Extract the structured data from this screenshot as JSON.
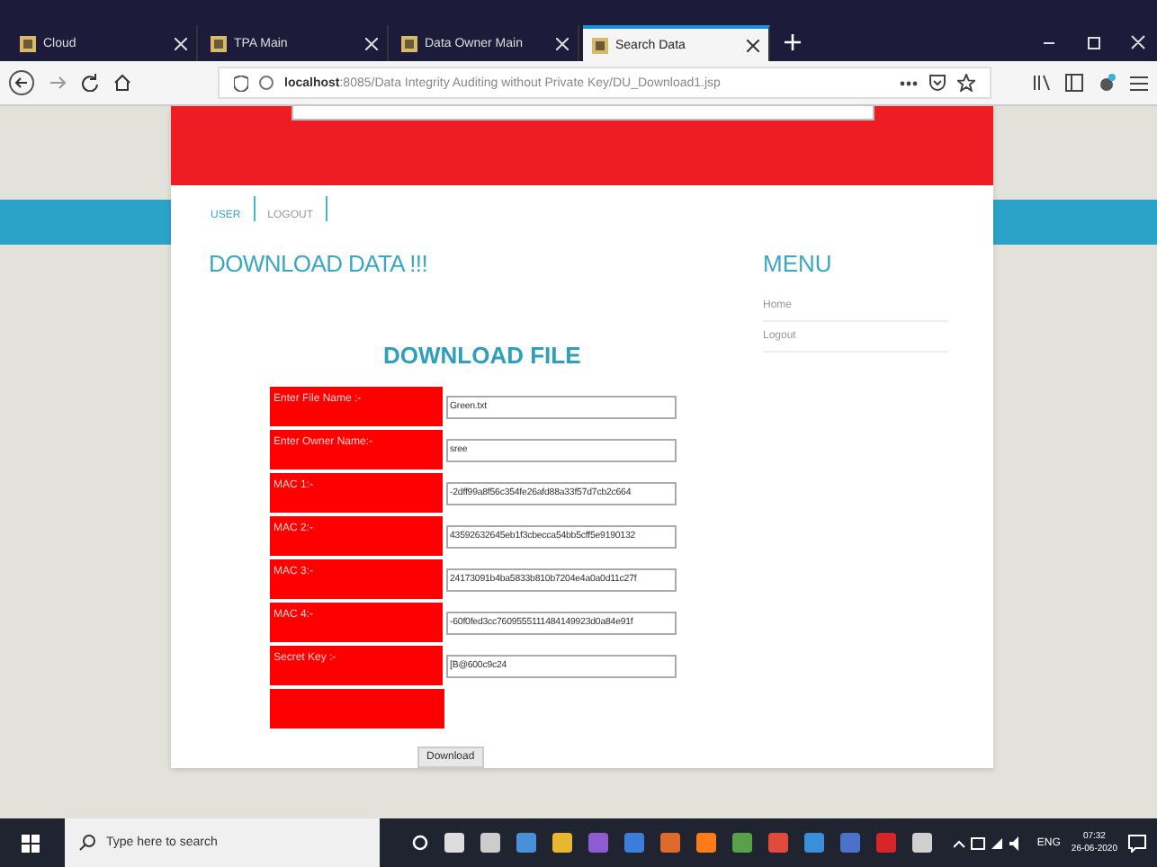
{
  "tabs": [
    {
      "label": "Cloud",
      "selected": false
    },
    {
      "label": "TPA Main",
      "selected": false
    },
    {
      "label": "Data Owner Main",
      "selected": false
    },
    {
      "label": "Search Data",
      "selected": true
    }
  ],
  "address": {
    "host": "localhost",
    "rest": ":8085/Data Integrity Auditing without Private Key/DU_Download1.jsp"
  },
  "nav": [
    "USER",
    "LOGOUT"
  ],
  "heading": "DOWNLOAD DATA !!!",
  "menu": {
    "title": "MENU",
    "items": [
      "Home",
      "Logout"
    ]
  },
  "form": {
    "title": "DOWNLOAD FILE",
    "rows": [
      {
        "label": "Enter File Name :-",
        "value": "Green.txt"
      },
      {
        "label": "Enter Owner Name:-",
        "value": "sree"
      },
      {
        "label": "MAC 1:-",
        "value": "-2dff99a8f56c354fe26afd88a33f57d7cb2c664"
      },
      {
        "label": "MAC 2:-",
        "value": "43592632645eb1f3cbecca54bb5cff5e9190132"
      },
      {
        "label": "MAC 3:-",
        "value": "24173091b4ba5833b810b7204e4a0a0d11c27f"
      },
      {
        "label": "MAC 4:-",
        "value": "-60f0fed3cc7609555111484149923d0a84e91f"
      },
      {
        "label": "Secret Key :-",
        "value": "[B@600c9c24"
      }
    ],
    "button": "Download"
  },
  "taskbar": {
    "search_placeholder": "Type here to search",
    "lang": "ENG",
    "time": "07:32",
    "date": "26-06-2020"
  }
}
